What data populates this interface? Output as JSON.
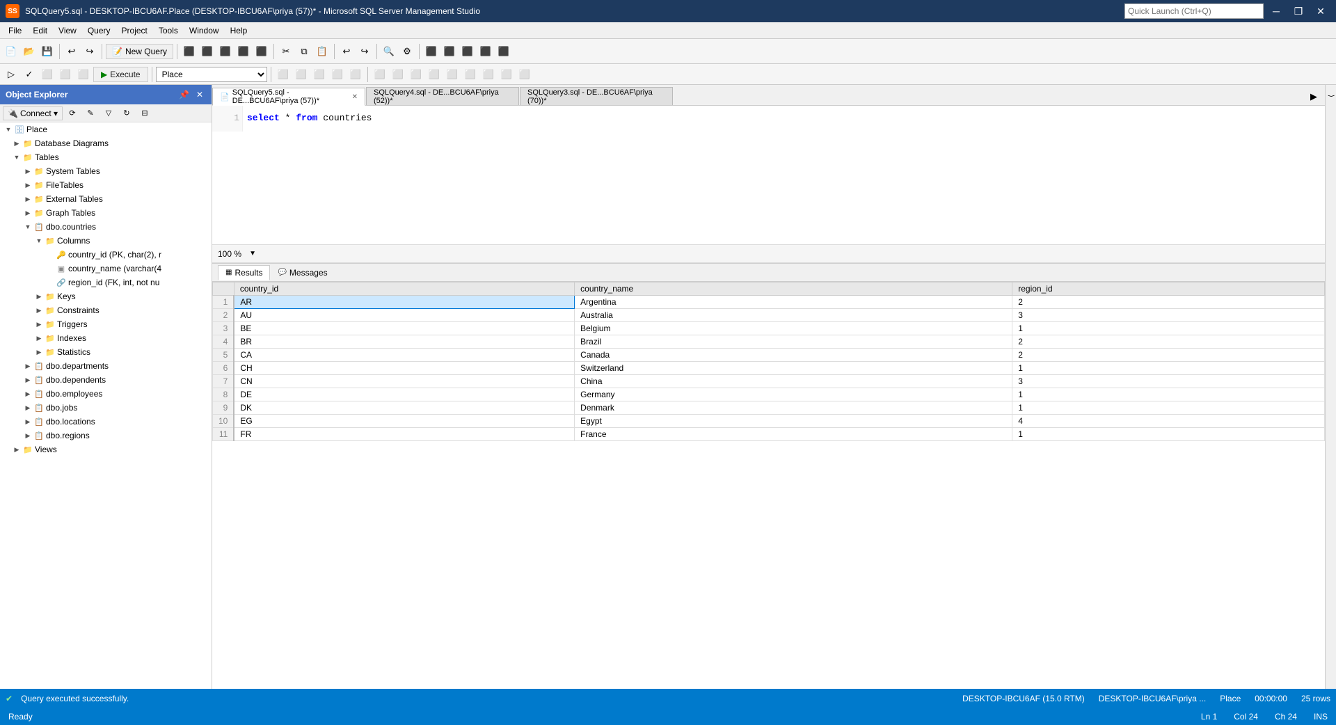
{
  "titlebar": {
    "title": "SQLQuery5.sql - DESKTOP-IBCU6AF.Place (DESKTOP-IBCU6AF\\priya (57))* - Microsoft SQL Server Management Studio",
    "icon_text": "SS",
    "minimize": "─",
    "restore": "❐",
    "close": "✕"
  },
  "menubar": {
    "items": [
      "File",
      "Edit",
      "View",
      "Query",
      "Project",
      "Tools",
      "Window",
      "Help"
    ]
  },
  "toolbar": {
    "new_query_label": "New Query",
    "execute_label": "▶ Execute",
    "database_value": "Place",
    "quick_launch_placeholder": "Quick Launch (Ctrl+Q)"
  },
  "object_explorer": {
    "title": "Object Explorer",
    "connect_label": "Connect",
    "tree": [
      {
        "id": "place",
        "label": "Place",
        "level": 1,
        "type": "db",
        "expanded": true
      },
      {
        "id": "db-diagrams",
        "label": "Database Diagrams",
        "level": 2,
        "type": "folder"
      },
      {
        "id": "tables",
        "label": "Tables",
        "level": 2,
        "type": "folder",
        "expanded": true
      },
      {
        "id": "system-tables",
        "label": "System Tables",
        "level": 3,
        "type": "folder"
      },
      {
        "id": "filetables",
        "label": "FileTables",
        "level": 3,
        "type": "folder"
      },
      {
        "id": "external-tables",
        "label": "External Tables",
        "level": 3,
        "type": "folder"
      },
      {
        "id": "graph-tables",
        "label": "Graph Tables",
        "level": 3,
        "type": "folder"
      },
      {
        "id": "dbo-countries",
        "label": "dbo.countries",
        "level": 3,
        "type": "table",
        "expanded": true
      },
      {
        "id": "columns",
        "label": "Columns",
        "level": 4,
        "type": "folder",
        "expanded": true
      },
      {
        "id": "col-country-id",
        "label": "country_id (PK, char(2), r",
        "level": 5,
        "type": "pk-col"
      },
      {
        "id": "col-country-name",
        "label": "country_name (varchar(4",
        "level": 5,
        "type": "col"
      },
      {
        "id": "col-region-id",
        "label": "region_id (FK, int, not nu",
        "level": 5,
        "type": "fk-col"
      },
      {
        "id": "keys",
        "label": "Keys",
        "level": 4,
        "type": "folder"
      },
      {
        "id": "constraints",
        "label": "Constraints",
        "level": 4,
        "type": "folder"
      },
      {
        "id": "triggers",
        "label": "Triggers",
        "level": 4,
        "type": "folder"
      },
      {
        "id": "indexes",
        "label": "Indexes",
        "level": 4,
        "type": "folder"
      },
      {
        "id": "statistics",
        "label": "Statistics",
        "level": 4,
        "type": "folder"
      },
      {
        "id": "dbo-departments",
        "label": "dbo.departments",
        "level": 3,
        "type": "table"
      },
      {
        "id": "dbo-dependents",
        "label": "dbo.dependents",
        "level": 3,
        "type": "table"
      },
      {
        "id": "dbo-employees",
        "label": "dbo.employees",
        "level": 3,
        "type": "table"
      },
      {
        "id": "dbo-jobs",
        "label": "dbo.jobs",
        "level": 3,
        "type": "table"
      },
      {
        "id": "dbo-locations",
        "label": "dbo.locations",
        "level": 3,
        "type": "table"
      },
      {
        "id": "dbo-regions",
        "label": "dbo.regions",
        "level": 3,
        "type": "table"
      },
      {
        "id": "views",
        "label": "Views",
        "level": 2,
        "type": "folder"
      }
    ]
  },
  "tabs": [
    {
      "id": "tab1",
      "label": "SQLQuery5.sql - DE...BCU6AF\\priya (57))*",
      "active": true,
      "modified": true
    },
    {
      "id": "tab2",
      "label": "SQLQuery4.sql - DE...BCU6AF\\priya (52))*",
      "active": false,
      "modified": true
    },
    {
      "id": "tab3",
      "label": "SQLQuery3.sql - DE...BCU6AF\\priya (70))*",
      "active": false,
      "modified": true
    }
  ],
  "editor": {
    "content": "select * from countries",
    "zoom": "100 %"
  },
  "results_panel": {
    "tabs": [
      {
        "id": "results",
        "label": "Results",
        "active": true
      },
      {
        "id": "messages",
        "label": "Messages",
        "active": false
      }
    ],
    "columns": [
      "country_id",
      "country_name",
      "region_id"
    ],
    "rows": [
      {
        "num": "1",
        "country_id": "AR",
        "country_name": "Argentina",
        "region_id": "2",
        "selected": true
      },
      {
        "num": "2",
        "country_id": "AU",
        "country_name": "Australia",
        "region_id": "3"
      },
      {
        "num": "3",
        "country_id": "BE",
        "country_name": "Belgium",
        "region_id": "1"
      },
      {
        "num": "4",
        "country_id": "BR",
        "country_name": "Brazil",
        "region_id": "2"
      },
      {
        "num": "5",
        "country_id": "CA",
        "country_name": "Canada",
        "region_id": "2"
      },
      {
        "num": "6",
        "country_id": "CH",
        "country_name": "Switzerland",
        "region_id": "1"
      },
      {
        "num": "7",
        "country_id": "CN",
        "country_name": "China",
        "region_id": "3"
      },
      {
        "num": "8",
        "country_id": "DE",
        "country_name": "Germany",
        "region_id": "1"
      },
      {
        "num": "9",
        "country_id": "DK",
        "country_name": "Denmark",
        "region_id": "1"
      },
      {
        "num": "10",
        "country_id": "EG",
        "country_name": "Egypt",
        "region_id": "4"
      },
      {
        "num": "11",
        "country_id": "FR",
        "country_name": "France",
        "region_id": "1"
      }
    ]
  },
  "statusbar": {
    "success_message": "Query executed successfully.",
    "server": "DESKTOP-IBCU6AF (15.0 RTM)",
    "user": "DESKTOP-IBCU6AF\\priya ...",
    "database": "Place",
    "time": "00:00:00",
    "rows": "25 rows"
  },
  "footer": {
    "ready": "Ready",
    "ln": "Ln 1",
    "col": "Col 24",
    "ch": "Ch 24",
    "ins": "INS"
  }
}
